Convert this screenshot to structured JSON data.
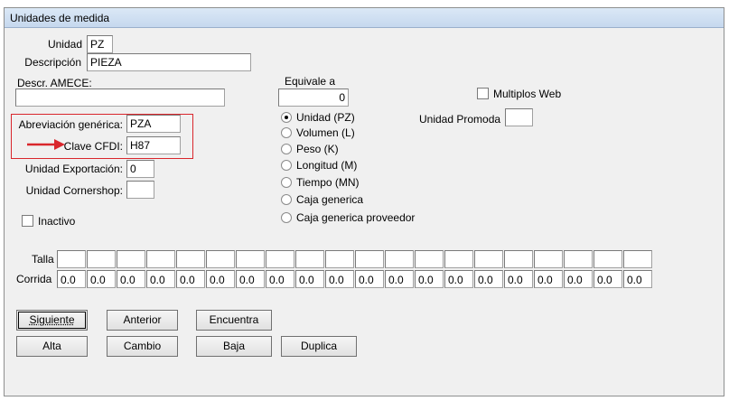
{
  "window": {
    "title": "Unidades de medida"
  },
  "form": {
    "unidad": {
      "label": "Unidad",
      "value": "PZ"
    },
    "descripcion": {
      "label": "Descripción",
      "value": "PIEZA"
    },
    "descr_amece": {
      "label": "Descr. AMECE:",
      "value": ""
    },
    "abreviacion": {
      "label": "Abreviación genérica:",
      "value": "PZA"
    },
    "clave_cfdi": {
      "label": "Clave CFDI:",
      "value": "H87"
    },
    "unidad_exportacion": {
      "label": "Unidad Exportación:",
      "value": "0"
    },
    "unidad_cornershop": {
      "label": "Unidad Cornershop:",
      "value": ""
    },
    "inactivo": {
      "label": "Inactivo",
      "checked": false
    },
    "equivale": {
      "label": "Equivale a",
      "value": "0"
    },
    "multiplos_web": {
      "label": "Multiplos Web",
      "checked": false
    },
    "unidad_promoda": {
      "label": "Unidad Promoda",
      "value": ""
    },
    "radio_options": [
      {
        "label": "Unidad (PZ)",
        "selected": true
      },
      {
        "label": "Volumen (L)",
        "selected": false
      },
      {
        "label": "Peso (K)",
        "selected": false
      },
      {
        "label": "Longitud (M)",
        "selected": false
      },
      {
        "label": "Tiempo (MN)",
        "selected": false
      },
      {
        "label": "Caja generica",
        "selected": false
      },
      {
        "label": "Caja generica proveedor",
        "selected": false
      }
    ]
  },
  "grid": {
    "talla_label": "Talla",
    "corrida_label": "Corrida",
    "talla": [
      "",
      "",
      "",
      "",
      "",
      "",
      "",
      "",
      "",
      "",
      "",
      "",
      "",
      "",
      "",
      "",
      "",
      "",
      "",
      ""
    ],
    "corrida": [
      "0.0",
      "0.0",
      "0.0",
      "0.0",
      "0.0",
      "0.0",
      "0.0",
      "0.0",
      "0.0",
      "0.0",
      "0.0",
      "0.0",
      "0.0",
      "0.0",
      "0.0",
      "0.0",
      "0.0",
      "0.0",
      "0.0",
      "0.0"
    ]
  },
  "buttons": {
    "siguiente": "Siguiente",
    "anterior": "Anterior",
    "encuentra": "Encuentra",
    "alta": "Alta",
    "cambio": "Cambio",
    "baja": "Baja",
    "duplica": "Duplica"
  },
  "colors": {
    "highlight": "#d9262c",
    "titlebar": "#c6d8ee"
  }
}
